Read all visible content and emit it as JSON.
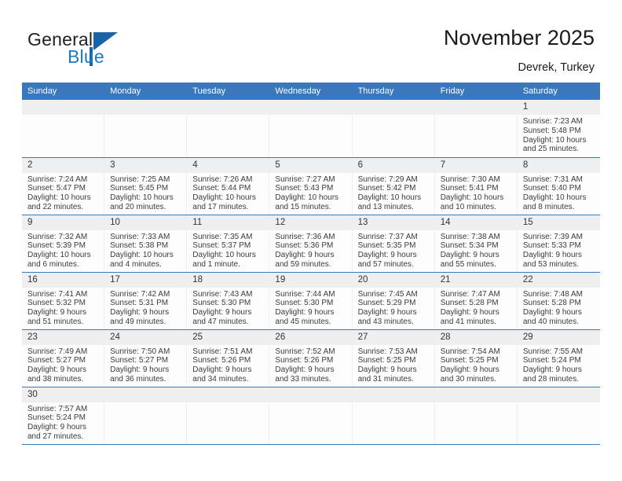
{
  "brand": {
    "name_top": "General",
    "name_bottom": "Blue",
    "accent_color": "#1b79c4",
    "triangle_icon": "triangle-icon"
  },
  "header": {
    "title": "November 2025",
    "location": "Devrek, Turkey"
  },
  "colors": {
    "header_blue": "#3a77bd",
    "daynum_band": "#efefef",
    "text": "#3b3b3b"
  },
  "weekdays": [
    "Sunday",
    "Monday",
    "Tuesday",
    "Wednesday",
    "Thursday",
    "Friday",
    "Saturday"
  ],
  "labels": {
    "sunrise": "Sunrise:",
    "sunset": "Sunset:",
    "daylight": "Daylight:"
  },
  "weeks": [
    [
      {
        "day": "",
        "empty": true
      },
      {
        "day": "",
        "empty": true
      },
      {
        "day": "",
        "empty": true
      },
      {
        "day": "",
        "empty": true
      },
      {
        "day": "",
        "empty": true
      },
      {
        "day": "",
        "empty": true
      },
      {
        "day": "1",
        "sunrise": "Sunrise: 7:23 AM",
        "sunset": "Sunset: 5:48 PM",
        "daylight_1": "Daylight: 10 hours",
        "daylight_2": "and 25 minutes."
      }
    ],
    [
      {
        "day": "2",
        "sunrise": "Sunrise: 7:24 AM",
        "sunset": "Sunset: 5:47 PM",
        "daylight_1": "Daylight: 10 hours",
        "daylight_2": "and 22 minutes."
      },
      {
        "day": "3",
        "sunrise": "Sunrise: 7:25 AM",
        "sunset": "Sunset: 5:45 PM",
        "daylight_1": "Daylight: 10 hours",
        "daylight_2": "and 20 minutes."
      },
      {
        "day": "4",
        "sunrise": "Sunrise: 7:26 AM",
        "sunset": "Sunset: 5:44 PM",
        "daylight_1": "Daylight: 10 hours",
        "daylight_2": "and 17 minutes."
      },
      {
        "day": "5",
        "sunrise": "Sunrise: 7:27 AM",
        "sunset": "Sunset: 5:43 PM",
        "daylight_1": "Daylight: 10 hours",
        "daylight_2": "and 15 minutes."
      },
      {
        "day": "6",
        "sunrise": "Sunrise: 7:29 AM",
        "sunset": "Sunset: 5:42 PM",
        "daylight_1": "Daylight: 10 hours",
        "daylight_2": "and 13 minutes."
      },
      {
        "day": "7",
        "sunrise": "Sunrise: 7:30 AM",
        "sunset": "Sunset: 5:41 PM",
        "daylight_1": "Daylight: 10 hours",
        "daylight_2": "and 10 minutes."
      },
      {
        "day": "8",
        "sunrise": "Sunrise: 7:31 AM",
        "sunset": "Sunset: 5:40 PM",
        "daylight_1": "Daylight: 10 hours",
        "daylight_2": "and 8 minutes."
      }
    ],
    [
      {
        "day": "9",
        "sunrise": "Sunrise: 7:32 AM",
        "sunset": "Sunset: 5:39 PM",
        "daylight_1": "Daylight: 10 hours",
        "daylight_2": "and 6 minutes."
      },
      {
        "day": "10",
        "sunrise": "Sunrise: 7:33 AM",
        "sunset": "Sunset: 5:38 PM",
        "daylight_1": "Daylight: 10 hours",
        "daylight_2": "and 4 minutes."
      },
      {
        "day": "11",
        "sunrise": "Sunrise: 7:35 AM",
        "sunset": "Sunset: 5:37 PM",
        "daylight_1": "Daylight: 10 hours",
        "daylight_2": "and 1 minute."
      },
      {
        "day": "12",
        "sunrise": "Sunrise: 7:36 AM",
        "sunset": "Sunset: 5:36 PM",
        "daylight_1": "Daylight: 9 hours",
        "daylight_2": "and 59 minutes."
      },
      {
        "day": "13",
        "sunrise": "Sunrise: 7:37 AM",
        "sunset": "Sunset: 5:35 PM",
        "daylight_1": "Daylight: 9 hours",
        "daylight_2": "and 57 minutes."
      },
      {
        "day": "14",
        "sunrise": "Sunrise: 7:38 AM",
        "sunset": "Sunset: 5:34 PM",
        "daylight_1": "Daylight: 9 hours",
        "daylight_2": "and 55 minutes."
      },
      {
        "day": "15",
        "sunrise": "Sunrise: 7:39 AM",
        "sunset": "Sunset: 5:33 PM",
        "daylight_1": "Daylight: 9 hours",
        "daylight_2": "and 53 minutes."
      }
    ],
    [
      {
        "day": "16",
        "sunrise": "Sunrise: 7:41 AM",
        "sunset": "Sunset: 5:32 PM",
        "daylight_1": "Daylight: 9 hours",
        "daylight_2": "and 51 minutes."
      },
      {
        "day": "17",
        "sunrise": "Sunrise: 7:42 AM",
        "sunset": "Sunset: 5:31 PM",
        "daylight_1": "Daylight: 9 hours",
        "daylight_2": "and 49 minutes."
      },
      {
        "day": "18",
        "sunrise": "Sunrise: 7:43 AM",
        "sunset": "Sunset: 5:30 PM",
        "daylight_1": "Daylight: 9 hours",
        "daylight_2": "and 47 minutes."
      },
      {
        "day": "19",
        "sunrise": "Sunrise: 7:44 AM",
        "sunset": "Sunset: 5:30 PM",
        "daylight_1": "Daylight: 9 hours",
        "daylight_2": "and 45 minutes."
      },
      {
        "day": "20",
        "sunrise": "Sunrise: 7:45 AM",
        "sunset": "Sunset: 5:29 PM",
        "daylight_1": "Daylight: 9 hours",
        "daylight_2": "and 43 minutes."
      },
      {
        "day": "21",
        "sunrise": "Sunrise: 7:47 AM",
        "sunset": "Sunset: 5:28 PM",
        "daylight_1": "Daylight: 9 hours",
        "daylight_2": "and 41 minutes."
      },
      {
        "day": "22",
        "sunrise": "Sunrise: 7:48 AM",
        "sunset": "Sunset: 5:28 PM",
        "daylight_1": "Daylight: 9 hours",
        "daylight_2": "and 40 minutes."
      }
    ],
    [
      {
        "day": "23",
        "sunrise": "Sunrise: 7:49 AM",
        "sunset": "Sunset: 5:27 PM",
        "daylight_1": "Daylight: 9 hours",
        "daylight_2": "and 38 minutes."
      },
      {
        "day": "24",
        "sunrise": "Sunrise: 7:50 AM",
        "sunset": "Sunset: 5:27 PM",
        "daylight_1": "Daylight: 9 hours",
        "daylight_2": "and 36 minutes."
      },
      {
        "day": "25",
        "sunrise": "Sunrise: 7:51 AM",
        "sunset": "Sunset: 5:26 PM",
        "daylight_1": "Daylight: 9 hours",
        "daylight_2": "and 34 minutes."
      },
      {
        "day": "26",
        "sunrise": "Sunrise: 7:52 AM",
        "sunset": "Sunset: 5:26 PM",
        "daylight_1": "Daylight: 9 hours",
        "daylight_2": "and 33 minutes."
      },
      {
        "day": "27",
        "sunrise": "Sunrise: 7:53 AM",
        "sunset": "Sunset: 5:25 PM",
        "daylight_1": "Daylight: 9 hours",
        "daylight_2": "and 31 minutes."
      },
      {
        "day": "28",
        "sunrise": "Sunrise: 7:54 AM",
        "sunset": "Sunset: 5:25 PM",
        "daylight_1": "Daylight: 9 hours",
        "daylight_2": "and 30 minutes."
      },
      {
        "day": "29",
        "sunrise": "Sunrise: 7:55 AM",
        "sunset": "Sunset: 5:24 PM",
        "daylight_1": "Daylight: 9 hours",
        "daylight_2": "and 28 minutes."
      }
    ],
    [
      {
        "day": "30",
        "sunrise": "Sunrise: 7:57 AM",
        "sunset": "Sunset: 5:24 PM",
        "daylight_1": "Daylight: 9 hours",
        "daylight_2": "and 27 minutes."
      },
      {
        "day": "",
        "empty": true
      },
      {
        "day": "",
        "empty": true
      },
      {
        "day": "",
        "empty": true
      },
      {
        "day": "",
        "empty": true
      },
      {
        "day": "",
        "empty": true
      },
      {
        "day": "",
        "empty": true
      }
    ]
  ]
}
